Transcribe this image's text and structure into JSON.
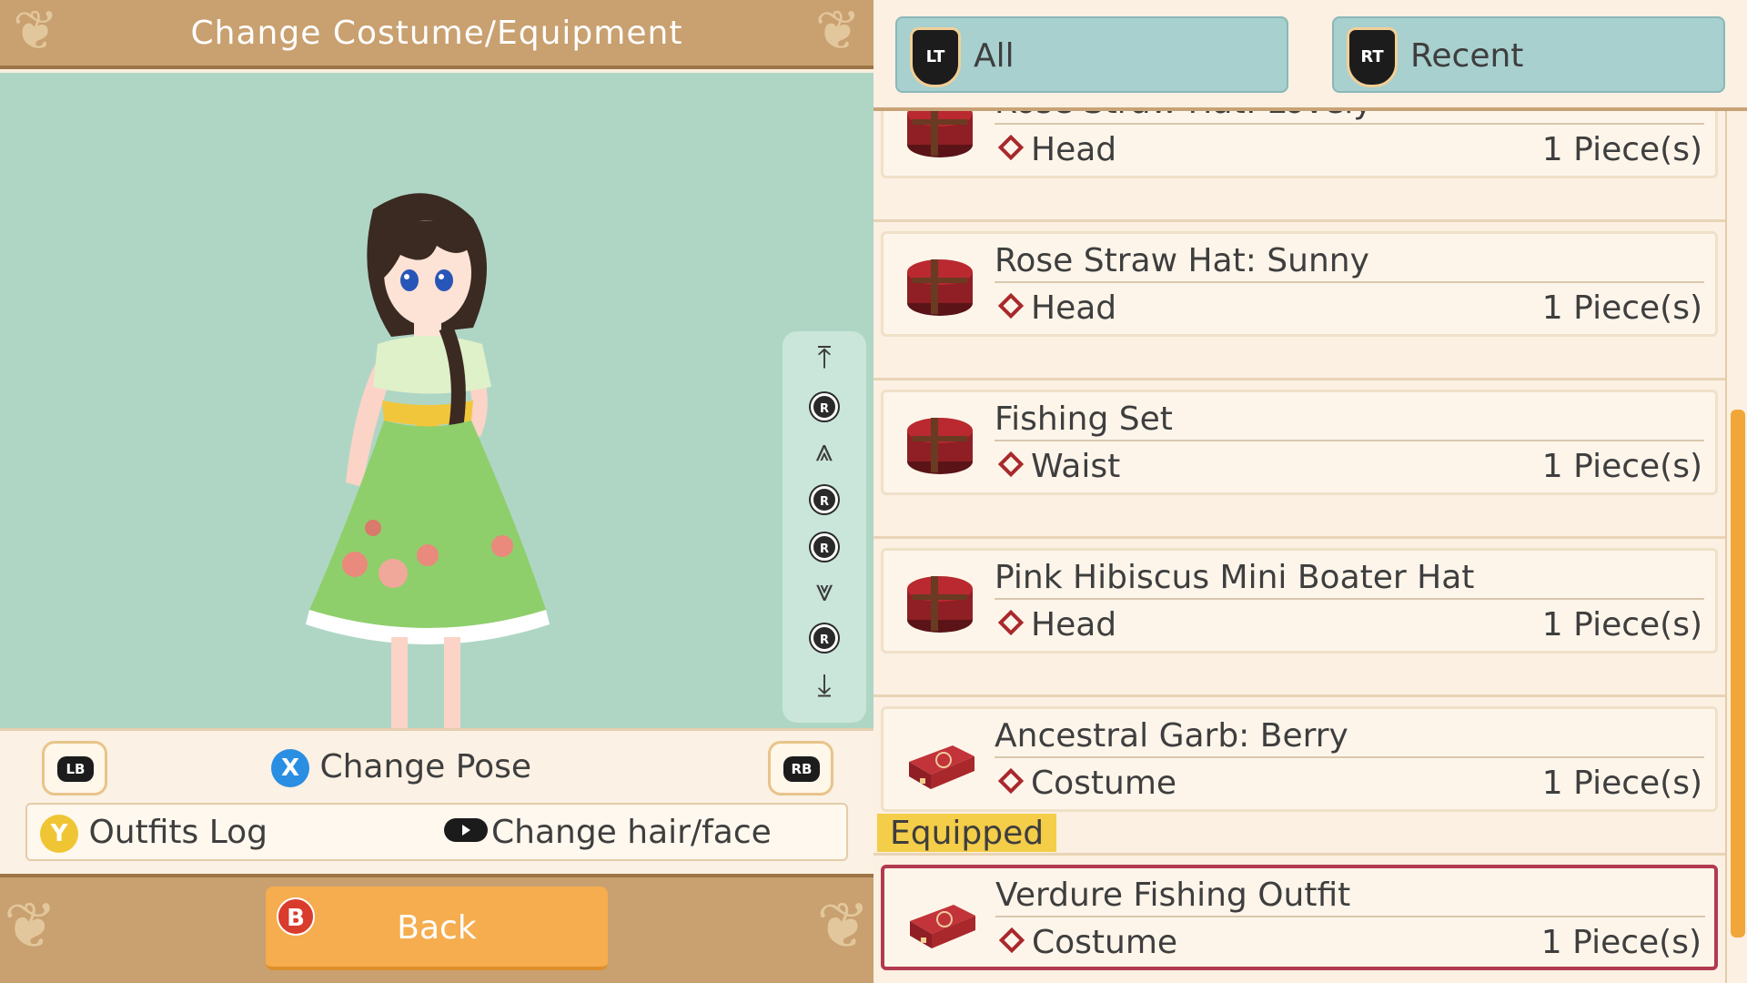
{
  "header": {
    "title": "Change Costume/Equipment"
  },
  "scroll_controls": {
    "top_icon": "scroll-to-top-icon",
    "r_up": "R",
    "page_up_icon": "double-chevron-up-icon",
    "r_left": "R",
    "r_right": "R",
    "page_down_icon": "double-chevron-down-icon",
    "r_down": "R",
    "bottom_icon": "scroll-to-bottom-icon"
  },
  "controls": {
    "lb": "LB",
    "rb": "RB",
    "x_button": "X",
    "change_pose": "Change Pose",
    "y_button": "Y",
    "outfits_log": "Outfits Log",
    "change_hair_face": "Change hair/face"
  },
  "footer": {
    "b_button": "B",
    "back_label": "Back"
  },
  "tabs": [
    {
      "trigger": "LT",
      "label": "All"
    },
    {
      "trigger": "RT",
      "label": "Recent"
    }
  ],
  "items": [
    {
      "name": "Rose Straw Hat: Lovely",
      "category": "Head",
      "quantity": "1 Piece(s)",
      "icon": "hatbox-icon"
    },
    {
      "name": "Rose Straw Hat: Sunny",
      "category": "Head",
      "quantity": "1 Piece(s)",
      "icon": "hatbox-icon"
    },
    {
      "name": "Fishing Set",
      "category": "Waist",
      "quantity": "1 Piece(s)",
      "icon": "hatbox-icon"
    },
    {
      "name": "Pink Hibiscus Mini Boater Hat",
      "category": "Head",
      "quantity": "1 Piece(s)",
      "icon": "hatbox-icon"
    },
    {
      "name": "Ancestral Garb: Berry",
      "category": "Costume",
      "quantity": "1 Piece(s)",
      "icon": "suitcase-icon"
    },
    {
      "name": "Verdure Fishing Outfit",
      "category": "Costume",
      "quantity": "1 Piece(s)",
      "icon": "suitcase-icon"
    }
  ],
  "equipped_label": "Equipped",
  "colors": {
    "frame": "#c9a070",
    "stage": "#afd6c5",
    "tab": "#a8d0cf",
    "back_button": "#f5ad4f",
    "equipped_tag": "#f4cd49",
    "equipped_border": "#b23a4f",
    "category_marker": "#a9282b",
    "scroll_thumb": "#f1a63a"
  }
}
